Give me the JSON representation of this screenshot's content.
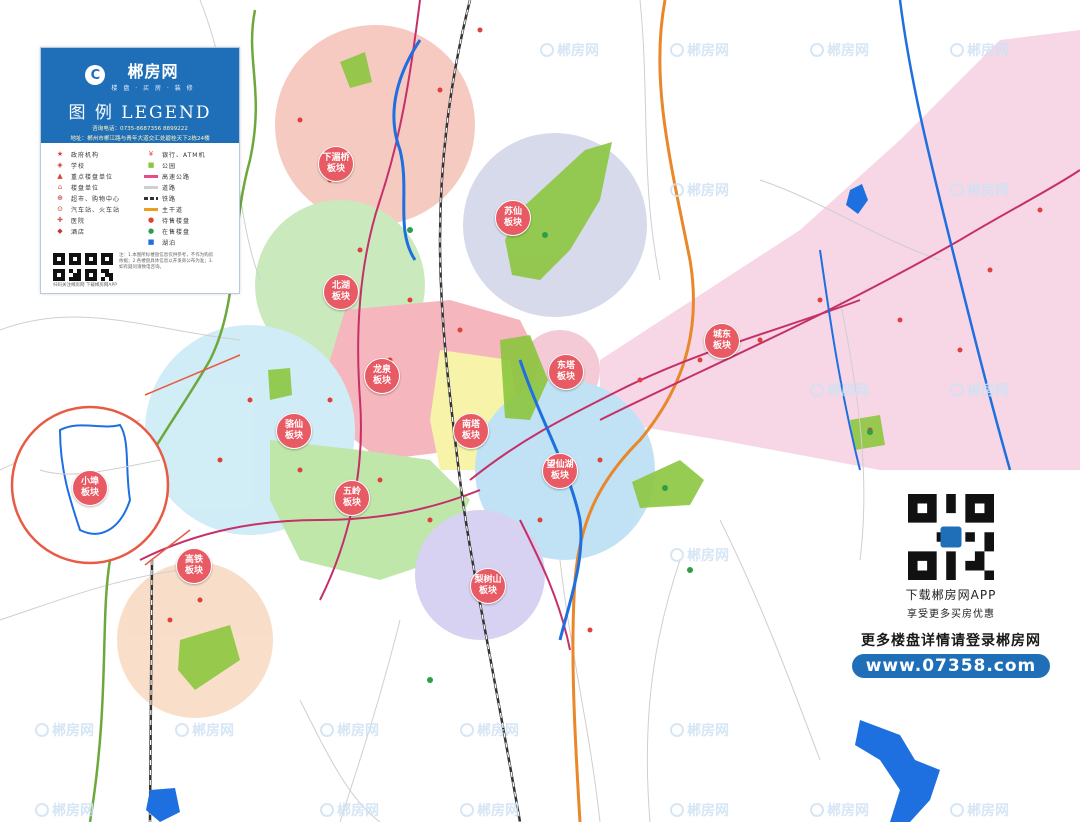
{
  "brand": {
    "name": "郴房网",
    "subtitle": "楼 盘 · 买 房 · 装 修"
  },
  "legend": {
    "title": "图 例 LEGEND",
    "phone": "咨询电话：0735-8687356  8899222",
    "address": "地址：郴州市郴江路与青年大道交汇处碧桂天下2栋24楼",
    "items": [
      {
        "label": "政府机构",
        "icon": "star-icon",
        "color": "#e0403a"
      },
      {
        "label": "银行、ATM机",
        "icon": "bank-icon",
        "color": "#e0403a"
      },
      {
        "label": "学校",
        "icon": "school-icon",
        "color": "#c0392b"
      },
      {
        "label": "公园",
        "icon": "park-icon",
        "color": "#8cc63f"
      },
      {
        "label": "重点楼盘单位",
        "icon": "building-icon",
        "color": "#e0403a"
      },
      {
        "label": "高速公路",
        "icon": "highway-line",
        "color": "#e84a8a"
      },
      {
        "label": "楼盘单位",
        "icon": "house-icon",
        "color": "#d9534f"
      },
      {
        "label": "道路",
        "icon": "road-line",
        "color": "#cfcfcf"
      },
      {
        "label": "超市、购物中心",
        "icon": "cart-icon",
        "color": "#c0392b"
      },
      {
        "label": "铁路",
        "icon": "rail-line",
        "color": "#333333"
      },
      {
        "label": "汽车站、火车站",
        "icon": "bus-icon",
        "color": "#c0392b"
      },
      {
        "label": "主干道",
        "icon": "trunk-line",
        "color": "#e8a020"
      },
      {
        "label": "医院",
        "icon": "hospital-icon",
        "color": "#d9534f"
      },
      {
        "label": "待售楼盘",
        "icon": "pin-icon",
        "color": "#e0403a"
      },
      {
        "label": "酒店",
        "icon": "hotel-icon",
        "color": "#c0392b"
      },
      {
        "label": "在售楼盘",
        "icon": "pin-green-icon",
        "color": "#2e9e48"
      },
      {
        "label": "",
        "icon": "",
        "color": ""
      },
      {
        "label": "湖泊",
        "icon": "lake-icon",
        "color": "#1e6fe0"
      }
    ],
    "note": "注：1.本图所标楼盘信息仅供参考，不作为购房依据；2.各楼盘具体信息以开发商公布为准；3.如有疑问请致电咨询。",
    "qr_caption": "扫码关注郴房网  下载郴房网APP"
  },
  "promo": {
    "download": "下载郴房网APP",
    "discount": "享受更多买房优惠",
    "more": "更多楼盘详情请登录郴房网",
    "url": "www.07358.com"
  },
  "watermark": "郴房网",
  "districts": [
    {
      "name": "下湄桥\n板块",
      "fill": "#f2b6a8"
    },
    {
      "name": "苏仙\n板块",
      "fill": "#c7cce3"
    },
    {
      "name": "北湖\n板块",
      "fill": "#b7e3a6"
    },
    {
      "name": "城东\n板块",
      "fill": "#f4c8dc"
    },
    {
      "name": "东塔\n板块",
      "fill": "#f2b6c8"
    },
    {
      "name": "龙泉\n板块",
      "fill": "#f39aa4"
    },
    {
      "name": "南塔\n板块",
      "fill": "#f5f08a"
    },
    {
      "name": "骆仙\n板块",
      "fill": "#bfe6f3"
    },
    {
      "name": "五岭\n板块",
      "fill": "#a8df8a"
    },
    {
      "name": "望仙湖\n板块",
      "fill": "#a9d8f0"
    },
    {
      "name": "梨树山\n板块",
      "fill": "#c9c0ee"
    },
    {
      "name": "高铁\n板块",
      "fill": "#f6d2b4"
    },
    {
      "name": "小埠\n板块",
      "fill": "#ffffff"
    }
  ],
  "colors": {
    "brand_blue": "#1e6fb8",
    "district_label": "#e85a64",
    "lake": "#1e6fe0"
  }
}
